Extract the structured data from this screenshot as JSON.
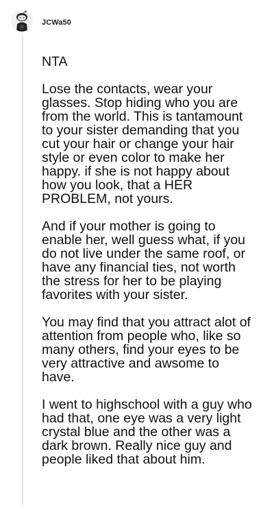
{
  "comment": {
    "username": "JCWa50",
    "paragraphs": [
      "NTA",
      "Lose the contacts, wear your glasses. Stop hiding who you are from the world. This is tantamount to your sister demanding that you cut your hair or change your hair style or even color to make her happy. if she is not happy about how you look, that a HER PROBLEM, not yours.",
      "And if your mother is going to enable her, well guess what, if you do not live under the same roof, or have any financial ties, not worth the stress for her to be playing favorites with your sister.",
      "You may find that you attract alot of attention from people who, like so many others, find your eyes to be very attractive and awsome to have.",
      "I went to highschool with a guy who had that, one eye was a very light crystal blue and the other was a dark brown. Really nice guy and people liked that about him."
    ]
  },
  "icons": {
    "avatar": "snoo-avatar-icon"
  },
  "colors": {
    "thread_line": "#e6e6e6",
    "text": "#111111",
    "avatar_accent": "#ff4500"
  }
}
